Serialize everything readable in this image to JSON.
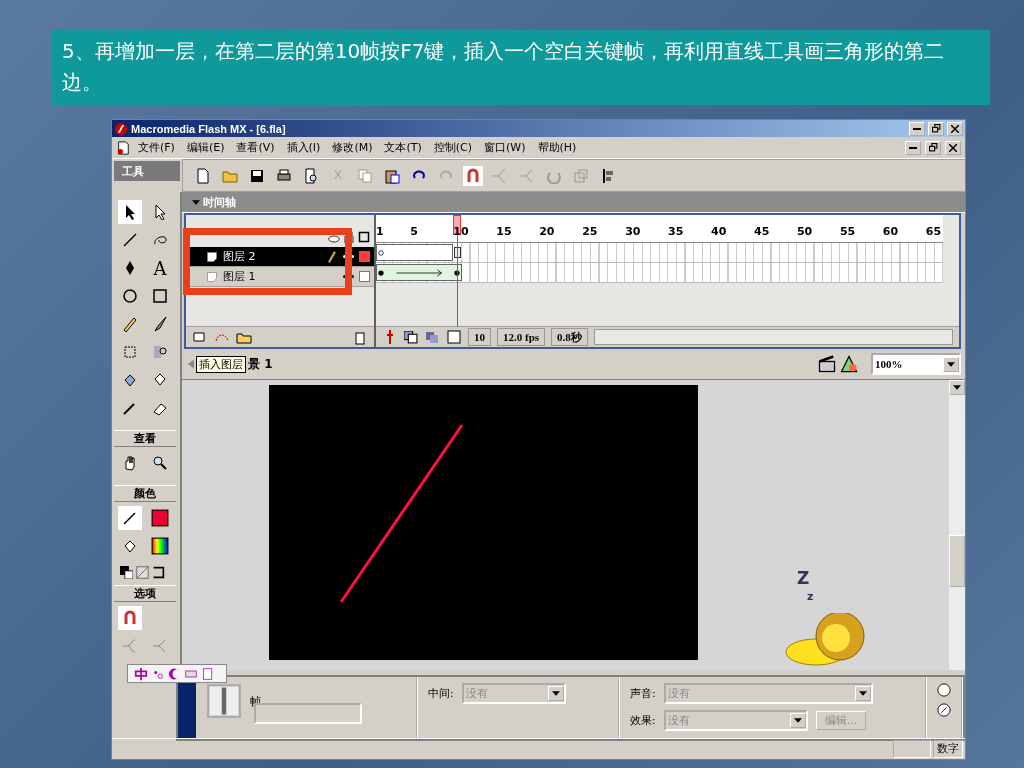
{
  "slide": {
    "caption": "5、再增加一层，在第二层的第10帧按F7键，插入一个空白关键帧，再利用直线工具画三角形的第二边。"
  },
  "window": {
    "title": "Macromedia Flash MX - [6.fla]"
  },
  "menu": [
    "文件(F)",
    "编辑(E)",
    "查看(V)",
    "插入(I)",
    "修改(M)",
    "文本(T)",
    "控制(C)",
    "窗口(W)",
    "帮助(H)"
  ],
  "tools_panel": {
    "title": "工具",
    "text_tool": "A",
    "view_title": "查看",
    "color_title": "颜色",
    "options_title": "选项"
  },
  "timeline": {
    "title": "时间轴",
    "frame_numbers": [
      "1",
      "5",
      "10",
      "15",
      "20",
      "25",
      "30",
      "35",
      "40",
      "45",
      "50",
      "55",
      "60",
      "65"
    ],
    "layers": [
      {
        "name": "图层 2",
        "selected": true,
        "kind": "blank",
        "color": "#ff3b3b"
      },
      {
        "name": "图层 1",
        "selected": false,
        "kind": "tween",
        "color": "#3b7bff"
      }
    ],
    "current_frame": "10",
    "frame_rate": "12.0 fps",
    "elapsed": "0.8秒"
  },
  "stage": {
    "tooltip": "插入图层",
    "scene": "景 1",
    "zoom": "100%",
    "marks": [
      "Z",
      "z"
    ]
  },
  "properties": {
    "frame_label": "帧",
    "tween_label": "中间:",
    "tween_value": "没有",
    "sound_label": "声音:",
    "sound_value": "没有",
    "effect_label": "效果:",
    "effect_value": "没有",
    "edit_button": "编辑..."
  },
  "status_bar": {
    "indicator": "数字"
  }
}
